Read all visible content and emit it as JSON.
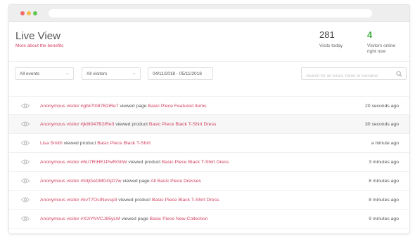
{
  "header": {
    "title": "Live View",
    "benefits_link": "More about the benefits"
  },
  "stats": {
    "visits_today": {
      "value": "281",
      "label": "Visits today"
    },
    "visitors_online": {
      "value": "4",
      "label": "Visitors online right now"
    }
  },
  "filters": {
    "events": "All events",
    "visitors": "All visitors",
    "date_range": "04/11/2018 - 05/11/2018",
    "search_placeholder": "Search for an email, name or surname"
  },
  "activity": [
    {
      "actor": "Anonymous visitor #ghk7t087B2iRe7",
      "action": " viewed page ",
      "target": "Basic Piece Featured Items",
      "time": "20 seconds ago"
    },
    {
      "actor": "Anonymous visitor #jk8t047B2iRe3",
      "action": " viewed product ",
      "target": "Basic Piece Black T-Shirt Dress",
      "time": "30 seconds ago"
    },
    {
      "actor": "Lisa Smith",
      "action": " viewed product ",
      "target": "Basic Piece Black T-Shirt",
      "time": "a minute ago"
    },
    {
      "actor": "Anonymous visitor #6U7RIHE1PwRGbW",
      "action": "  viewed product ",
      "target": "Basic Piece Black T-Shirt Dress",
      "time": "3 minutes ago"
    },
    {
      "actor": "Anonymous visitor #foljGeDMGGjO7w",
      "action": "  viewed page ",
      "target": "All Basic Piece Dresses",
      "time": "8 minutes ago"
    },
    {
      "actor": "Anonymous visitor #kvT7OsINevsp3",
      "action": "  viewed product ",
      "target": "Basic Piece Black T-Shirt Dress",
      "time": "8 minutes ago"
    },
    {
      "actor": "Anonymous visitor #X2iYNVCJ85yLM",
      "action": "  viewed page ",
      "target": "Basic Piece New Collection",
      "time": "9 minutes ago"
    }
  ],
  "colors": {
    "accent": "#d0405f",
    "online": "#3fae3f"
  }
}
